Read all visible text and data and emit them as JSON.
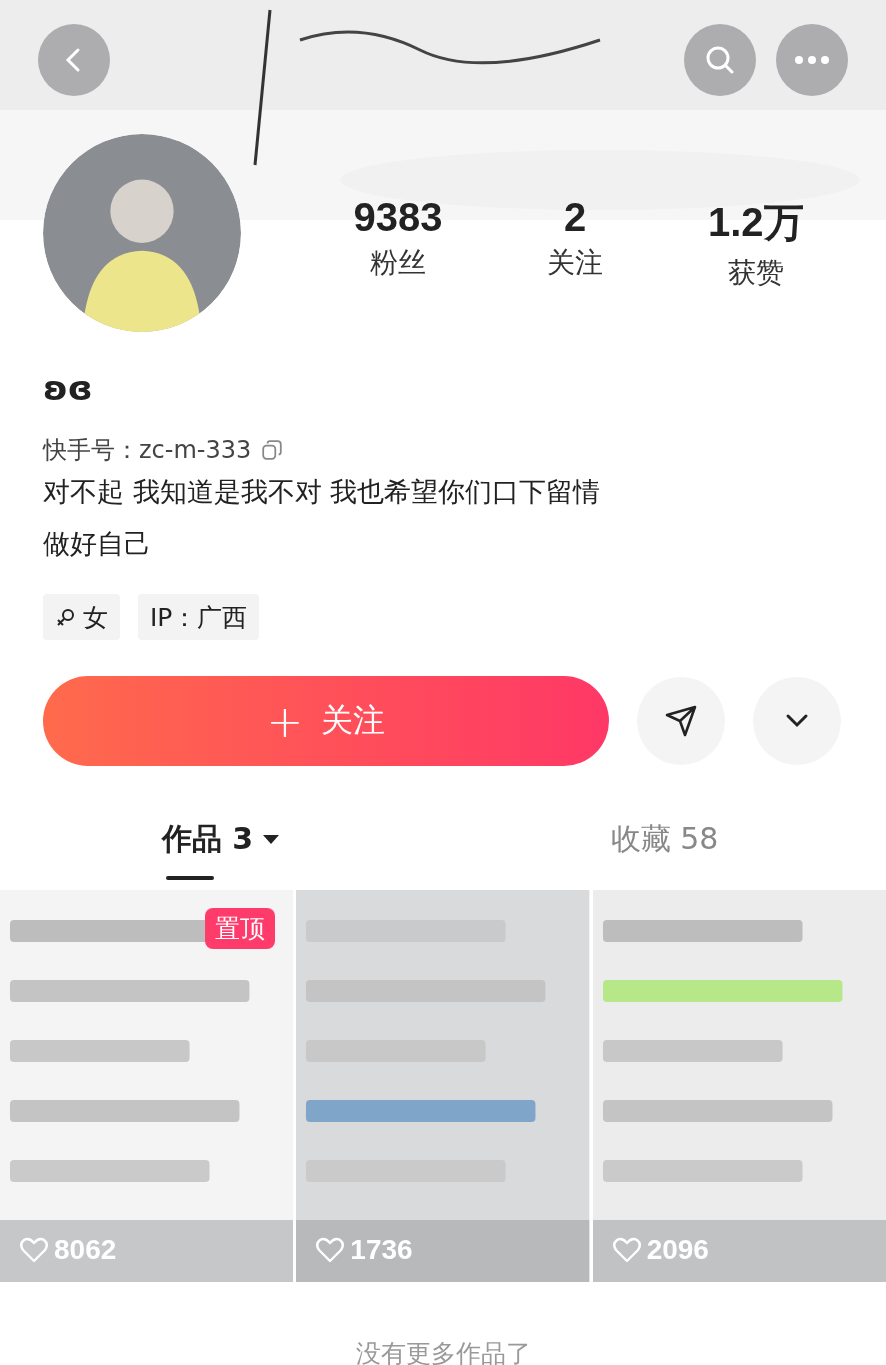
{
  "stats": [
    {
      "value": "9383",
      "label": "粉丝"
    },
    {
      "value": "2",
      "label": "关注"
    },
    {
      "value": "1.2万",
      "label": "获赞"
    }
  ],
  "name": "ʚɞ",
  "account_id": "快手号：zc-m-333",
  "bio": [
    "对不起 我知道是我不对 我也希望你们口下留情",
    "做好自己"
  ],
  "tags": [
    {
      "kind": "gender",
      "text": "女"
    },
    {
      "kind": "plain",
      "text": "IP：广西"
    }
  ],
  "follow_button": {
    "icon": "+",
    "label": "关注"
  },
  "tabs": [
    {
      "label": "作品 3",
      "selected": true,
      "dropdown": true
    },
    {
      "label": "收藏 58",
      "selected": false,
      "dropdown": false
    }
  ],
  "works": [
    {
      "kind": "picture",
      "pinned": true,
      "pin_label": "置顶",
      "likes": "8062"
    },
    {
      "kind": "picture",
      "pinned": false,
      "likes": "1736"
    },
    {
      "kind": "picture",
      "pinned": false,
      "likes": "2096"
    }
  ],
  "footer": "没有更多作品了"
}
